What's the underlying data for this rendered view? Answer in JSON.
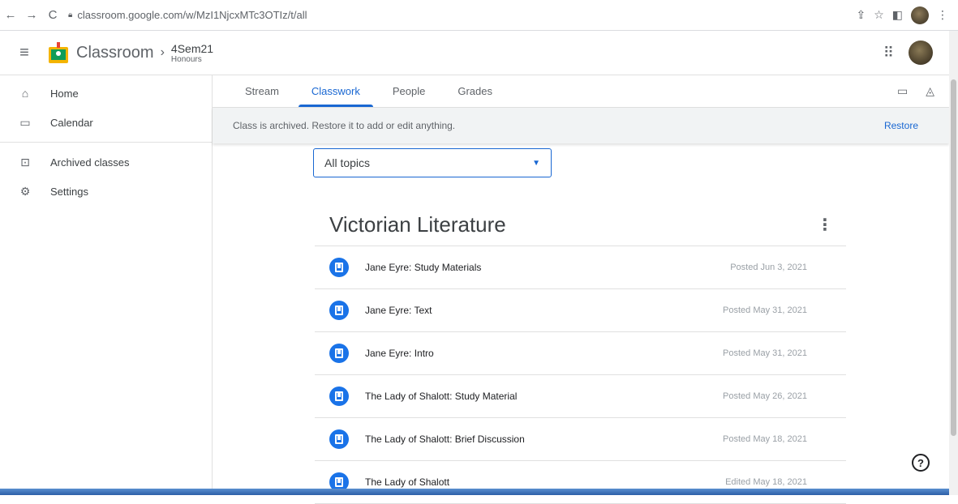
{
  "browser": {
    "url": "classroom.google.com/w/MzI1NjcxMTc3OTIz/t/all",
    "back_icon": "back-arrow-icon",
    "forward_icon": "forward-arrow-icon",
    "reload_icon": "reload-icon"
  },
  "header": {
    "brand": "Classroom",
    "class_name": "4Sem21",
    "class_section": "Honours"
  },
  "sidebar": {
    "items": [
      {
        "label": "Home",
        "icon": "home-icon"
      },
      {
        "label": "Calendar",
        "icon": "calendar-icon"
      },
      {
        "label": "Archived classes",
        "icon": "archive-icon"
      },
      {
        "label": "Settings",
        "icon": "gear-icon"
      }
    ]
  },
  "tabs": [
    {
      "label": "Stream",
      "active": false
    },
    {
      "label": "Classwork",
      "active": true
    },
    {
      "label": "People",
      "active": false
    },
    {
      "label": "Grades",
      "active": false
    }
  ],
  "banner": {
    "message": "Class is archived. Restore it to add or edit anything.",
    "action": "Restore"
  },
  "topic_filter": {
    "selected": "All topics"
  },
  "topic": {
    "title": "Victorian Literature",
    "items": [
      {
        "title": "Jane Eyre: Study Materials",
        "date": "Posted Jun 3, 2021"
      },
      {
        "title": "Jane Eyre: Text",
        "date": "Posted May 31, 2021"
      },
      {
        "title": "Jane Eyre: Intro",
        "date": "Posted May 31, 2021"
      },
      {
        "title": "The Lady of Shalott: Study Material",
        "date": "Posted May 26, 2021"
      },
      {
        "title": "The Lady of Shalott: Brief Discussion",
        "date": "Posted May 18, 2021"
      },
      {
        "title": "The Lady of Shalott",
        "date": "Edited May 18, 2021"
      }
    ]
  },
  "colors": {
    "accent": "#1967d2",
    "icon_blue": "#1a73e8"
  }
}
